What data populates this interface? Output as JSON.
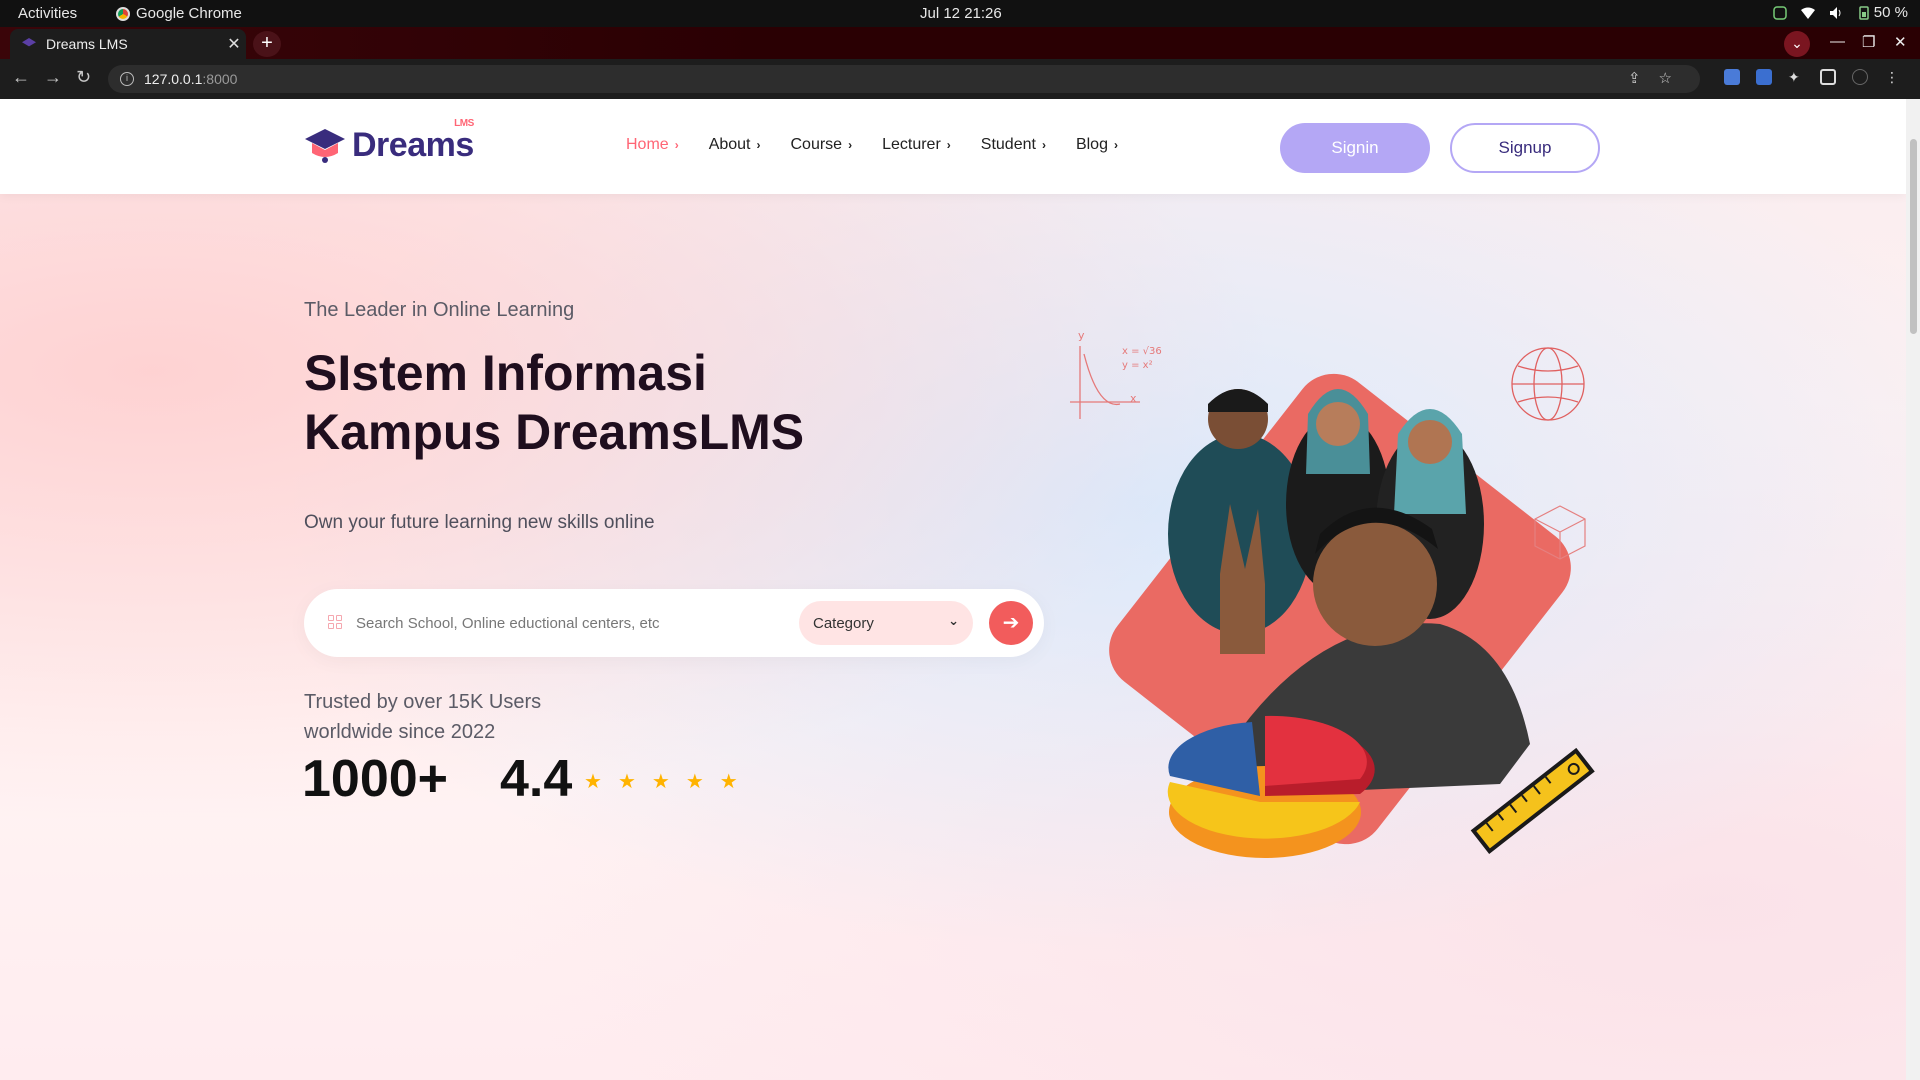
{
  "os": {
    "activities": "Activities",
    "app_name": "Google Chrome",
    "clock": "Jul 12  21:26",
    "battery": "50 %"
  },
  "browser": {
    "tab_title": "Dreams LMS",
    "tab_close": "✕",
    "new_tab": "+",
    "url_host": "127.0.0.1",
    "url_port": ":8000"
  },
  "site": {
    "logo_text": "Dreams",
    "logo_sup": "LMS",
    "nav": [
      {
        "label": "Home"
      },
      {
        "label": "About"
      },
      {
        "label": "Course"
      },
      {
        "label": "Lecturer"
      },
      {
        "label": "Student"
      },
      {
        "label": "Blog"
      }
    ],
    "signin": "Signin",
    "signup": "Signup",
    "accent": "#ff6575",
    "brand": "#392c7d"
  },
  "hero": {
    "eyebrow": "The Leader in Online Learning",
    "title": "SIstem Informasi Kampus DreamsLMS",
    "subtitle": "Own your future learning new skills online",
    "search_placeholder": "Search School, Online eductional centers, etc",
    "category": "Category",
    "trusted": "Trusted by over 15K Users worldwide since 2022",
    "users_stat": "1000+",
    "rating": "4.4",
    "stars": 5
  }
}
